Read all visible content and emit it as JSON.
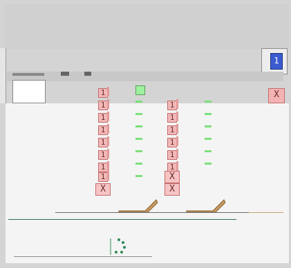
{
  "title": "",
  "blue_cube_label": "1",
  "red_cube_label": "X",
  "stack_left_label": "1",
  "stack_bottom_label": "X",
  "colors": {
    "background": "#d4d4d4",
    "stage_floor": "#f4f4f4",
    "cube_fill": "#f2b8b8",
    "cube_border": "#c46a6a",
    "blue_cube": "#3b5ccf",
    "green_dash": "#7be07b",
    "ramp": "#c79a63"
  }
}
